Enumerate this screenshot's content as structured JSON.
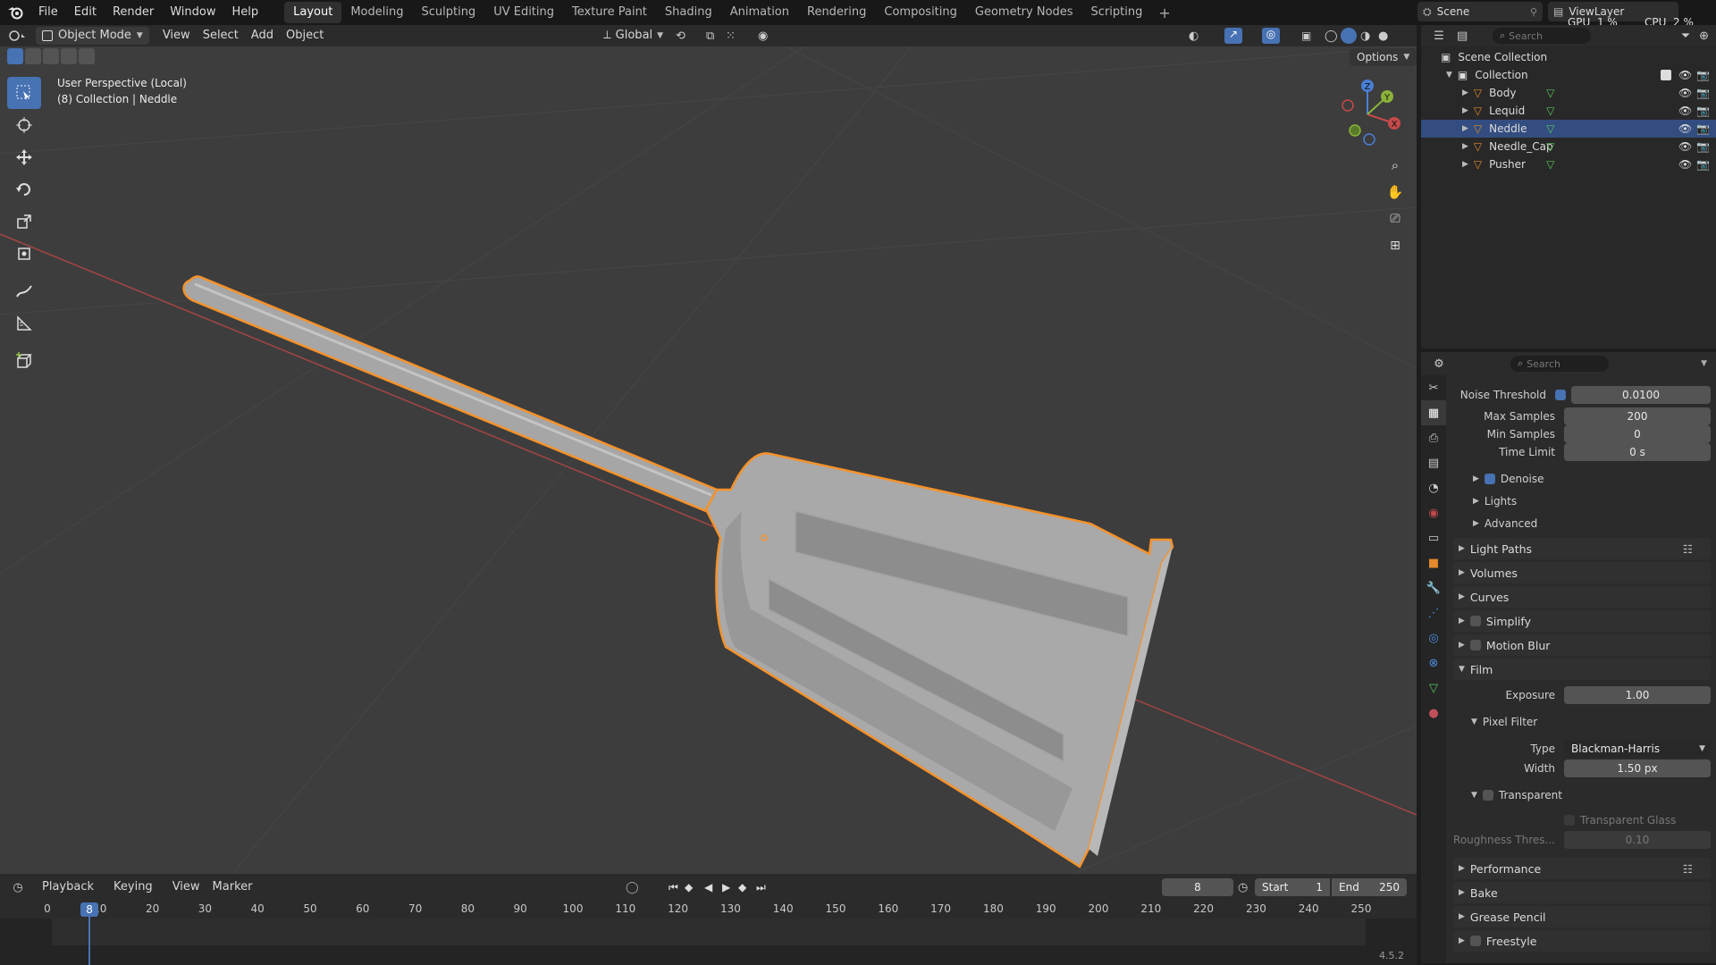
{
  "menu": [
    "File",
    "Edit",
    "Render",
    "Window",
    "Help"
  ],
  "workspaces": [
    "Layout",
    "Modeling",
    "Sculpting",
    "UV Editing",
    "Texture Paint",
    "Shading",
    "Animation",
    "Rendering",
    "Compositing",
    "Geometry Nodes",
    "Scripting"
  ],
  "active_workspace": "Layout",
  "top_right": {
    "scene": "Scene",
    "view_layer": "ViewLayer",
    "gpu": "GPU  1 %",
    "cpu": "CPU  2 %"
  },
  "viewport_header": {
    "mode": "Object Mode",
    "menus": [
      "View",
      "Select",
      "Add",
      "Object"
    ],
    "transform_orientation": "Global",
    "options": "Options"
  },
  "viewport_overlay": {
    "line1": "User Perspective (Local)",
    "line2": "(8) Collection | Neddle"
  },
  "gizmo_axes": {
    "x": "X",
    "y": "Y",
    "z": "Z"
  },
  "outliner": {
    "search_placeholder": "Search",
    "scene_collection": "Scene Collection",
    "collection": "Collection",
    "objects": [
      "Body",
      "Lequid",
      "Neddle",
      "Needle_Cap",
      "Pusher"
    ],
    "selected": "Neddle"
  },
  "properties": {
    "search_placeholder": "Search",
    "noise_threshold": {
      "label": "Noise Threshold",
      "value": "0.0100"
    },
    "max_samples": {
      "label": "Max Samples",
      "value": "200"
    },
    "min_samples": {
      "label": "Min Samples",
      "value": "0"
    },
    "time_limit": {
      "label": "Time Limit",
      "value": "0 s"
    },
    "denoise": "Denoise",
    "lights": "Lights",
    "advanced": "Advanced",
    "sections_a": [
      "Light Paths",
      "Volumes",
      "Curves",
      "Simplify",
      "Motion Blur"
    ],
    "film": "Film",
    "exposure": {
      "label": "Exposure",
      "value": "1.00"
    },
    "pixel_filter": "Pixel Filter",
    "filter_type": {
      "label": "Type",
      "value": "Blackman-Harris"
    },
    "filter_width": {
      "label": "Width",
      "value": "1.50 px"
    },
    "transparent": "Transparent",
    "transparent_glass": "Transparent Glass",
    "roughness": {
      "label": "Roughness Thres...",
      "value": "0.10"
    },
    "sections_b": [
      "Performance",
      "Bake",
      "Grease Pencil",
      "Freestyle"
    ]
  },
  "timeline": {
    "menus": [
      "Playback",
      "Keying",
      "View",
      "Marker"
    ],
    "current_frame": "8",
    "start_label": "Start",
    "start": "1",
    "end_label": "End",
    "end": "250",
    "ticks": [
      "0",
      "10",
      "20",
      "30",
      "40",
      "50",
      "60",
      "70",
      "80",
      "90",
      "100",
      "110",
      "120",
      "130",
      "140",
      "150",
      "160",
      "170",
      "180",
      "190",
      "200",
      "210",
      "220",
      "230",
      "240",
      "250"
    ],
    "playhead": "8"
  },
  "version": "4.5.2",
  "colors": {
    "accent": "#4772b3",
    "selection_outline": "#f5922b",
    "viewport_bg": "#3d3d3d",
    "axis_x": "#c74a4a",
    "axis_y": "#8bb33a",
    "axis_z": "#4a7fd6"
  }
}
